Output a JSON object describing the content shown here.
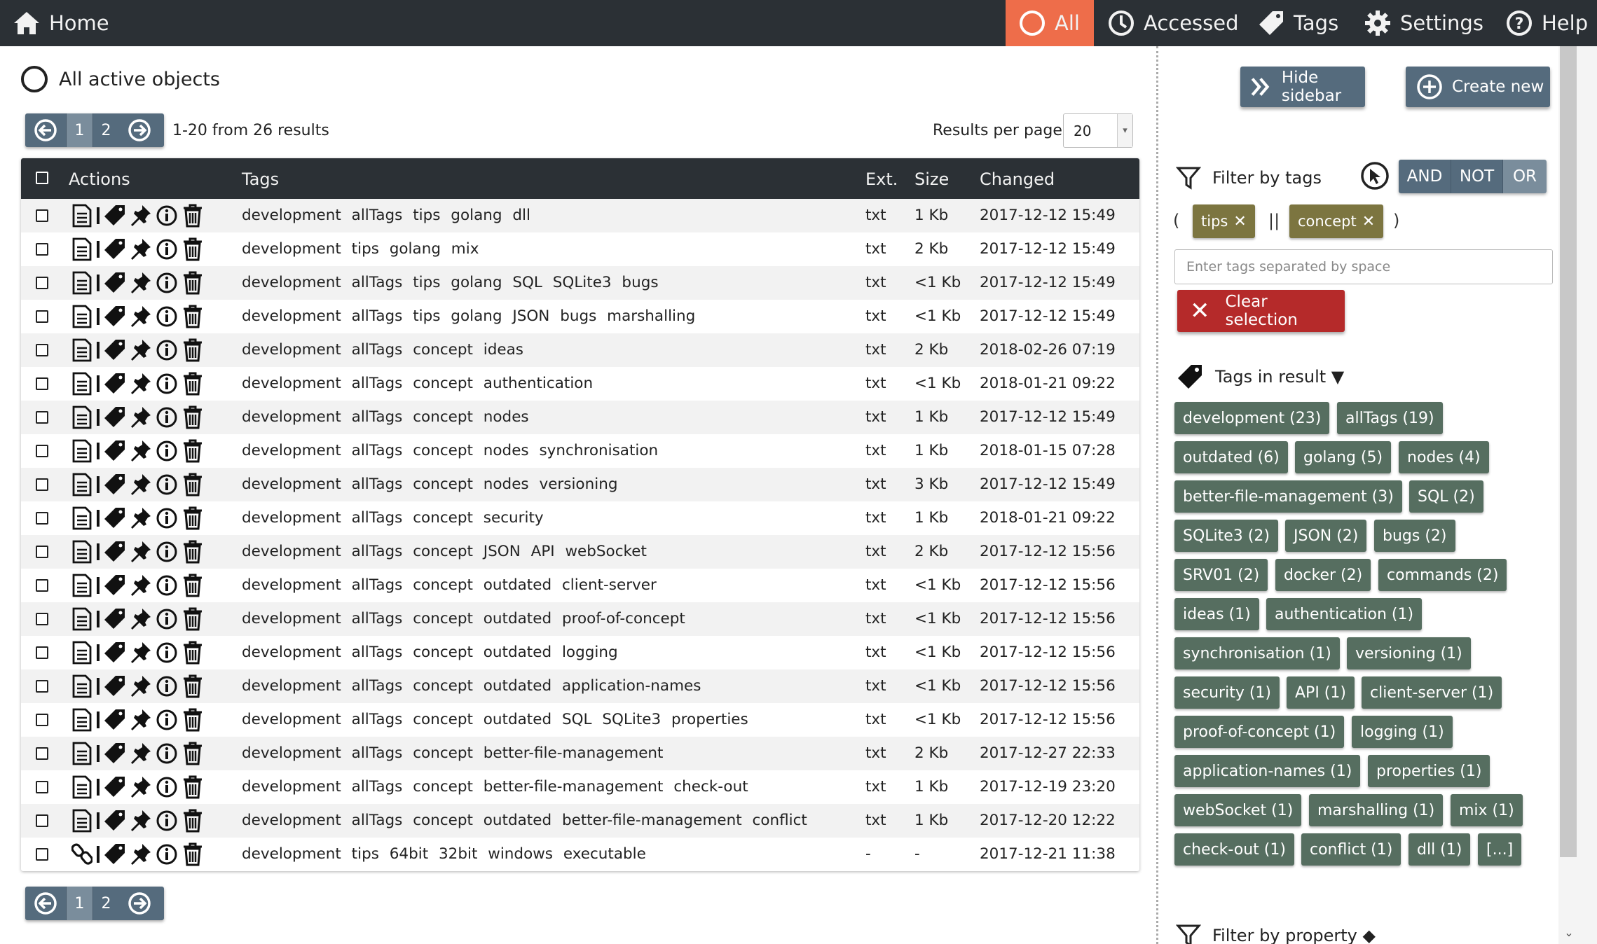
{
  "nav": {
    "home": "Home",
    "all": "All",
    "accessed": "Accessed",
    "tags": "Tags",
    "settings": "Settings",
    "help": "Help"
  },
  "main": {
    "title": "All active objects",
    "pager": {
      "pages": [
        "1",
        "2"
      ],
      "current": "1"
    },
    "results_info": "1-20 from 26 results",
    "per_page_label": "Results per page",
    "per_page_value": "20",
    "columns": {
      "actions": "Actions",
      "tags": "Tags",
      "ext": "Ext.",
      "size": "Size",
      "changed": "Changed"
    },
    "rows": [
      {
        "tags": "development allTags tips golang dll",
        "ext": "txt",
        "size": "1 Kb",
        "changed": "2017-12-12 15:49"
      },
      {
        "tags": "development tips golang mix",
        "ext": "txt",
        "size": "2 Kb",
        "changed": "2017-12-12 15:49"
      },
      {
        "tags": "development allTags tips golang SQL SQLite3 bugs",
        "ext": "txt",
        "size": "<1 Kb",
        "changed": "2017-12-12 15:49"
      },
      {
        "tags": "development allTags tips golang JSON bugs marshalling",
        "ext": "txt",
        "size": "<1 Kb",
        "changed": "2017-12-12 15:49"
      },
      {
        "tags": "development allTags concept ideas",
        "ext": "txt",
        "size": "2 Kb",
        "changed": "2018-02-26 07:19"
      },
      {
        "tags": "development allTags concept authentication",
        "ext": "txt",
        "size": "<1 Kb",
        "changed": "2018-01-21 09:22"
      },
      {
        "tags": "development allTags concept nodes",
        "ext": "txt",
        "size": "1 Kb",
        "changed": "2017-12-12 15:49"
      },
      {
        "tags": "development allTags concept nodes synchronisation",
        "ext": "txt",
        "size": "1 Kb",
        "changed": "2018-01-15 07:28"
      },
      {
        "tags": "development allTags concept nodes versioning",
        "ext": "txt",
        "size": "3 Kb",
        "changed": "2017-12-12 15:49"
      },
      {
        "tags": "development allTags concept security",
        "ext": "txt",
        "size": "1 Kb",
        "changed": "2018-01-21 09:22"
      },
      {
        "tags": "development allTags concept JSON API webSocket",
        "ext": "txt",
        "size": "2 Kb",
        "changed": "2017-12-12 15:56"
      },
      {
        "tags": "development allTags concept outdated client-server",
        "ext": "txt",
        "size": "<1 Kb",
        "changed": "2017-12-12 15:56"
      },
      {
        "tags": "development allTags concept outdated proof-of-concept",
        "ext": "txt",
        "size": "<1 Kb",
        "changed": "2017-12-12 15:56"
      },
      {
        "tags": "development allTags concept outdated logging",
        "ext": "txt",
        "size": "<1 Kb",
        "changed": "2017-12-12 15:56"
      },
      {
        "tags": "development allTags concept outdated application-names",
        "ext": "txt",
        "size": "<1 Kb",
        "changed": "2017-12-12 15:56"
      },
      {
        "tags": "development allTags concept outdated SQL SQLite3 properties",
        "ext": "txt",
        "size": "<1 Kb",
        "changed": "2017-12-12 15:56"
      },
      {
        "tags": "development allTags concept better-file-management",
        "ext": "txt",
        "size": "2 Kb",
        "changed": "2017-12-27 22:33"
      },
      {
        "tags": "development allTags concept better-file-management check-out",
        "ext": "txt",
        "size": "1 Kb",
        "changed": "2017-12-19 23:20"
      },
      {
        "tags": "development allTags concept outdated better-file-management conflict",
        "ext": "txt",
        "size": "1 Kb",
        "changed": "2017-12-20 12:22"
      },
      {
        "tags": "development tips 64bit 32bit windows executable",
        "ext": "-",
        "size": "-",
        "changed": "2017-12-21 11:38",
        "kind": "link"
      }
    ]
  },
  "sidebar": {
    "hide_sidebar": "Hide sidebar",
    "create_new": "Create new",
    "filter_by_tags": "Filter by tags",
    "logic": {
      "and": "AND",
      "not": "NOT",
      "or": "OR",
      "active": "OR"
    },
    "expression": {
      "open": "(",
      "op": "||",
      "close": ")",
      "tags": [
        "tips",
        "concept"
      ]
    },
    "tag_input_placeholder": "Enter tags separated by space",
    "clear_selection": "Clear selection",
    "tags_in_result": "Tags in result ▼",
    "tag_cloud": [
      "development (23)",
      "allTags (19)",
      "outdated (6)",
      "golang (5)",
      "nodes (4)",
      "better-file-management (3)",
      "SQL (2)",
      "SQLite3 (2)",
      "JSON (2)",
      "bugs (2)",
      "SRV01 (2)",
      "docker (2)",
      "commands (2)",
      "ideas (1)",
      "authentication (1)",
      "synchronisation (1)",
      "versioning (1)",
      "security (1)",
      "API (1)",
      "client-server (1)",
      "proof-of-concept (1)",
      "logging (1)",
      "application-names (1)",
      "properties (1)",
      "webSocket (1)",
      "marshalling (1)",
      "mix (1)",
      "check-out (1)",
      "conflict (1)",
      "dll (1)",
      "[...]"
    ],
    "filter_by_property": "Filter by property ◆"
  },
  "colors": {
    "nav_bg": "#2b3035",
    "nav_active": "#ee6d4a",
    "button": "#556b7d",
    "selected_tag": "#7c7540",
    "cloud_tag": "#566e60",
    "danger": "#b52a2a"
  }
}
